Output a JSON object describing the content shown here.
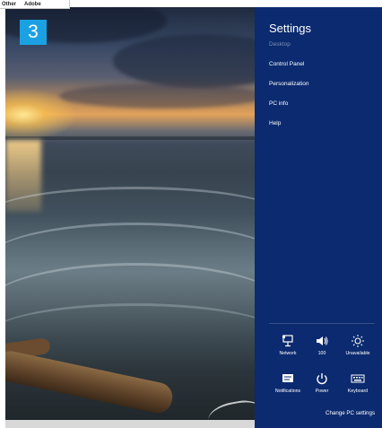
{
  "menubar": {
    "items": [
      "Other",
      "Adobe"
    ]
  },
  "step_badge": "3",
  "settings_pane": {
    "title": "Settings",
    "items": [
      {
        "label": "Desktop",
        "enabled": false
      },
      {
        "label": "Control Panel",
        "enabled": true
      },
      {
        "label": "Personalization",
        "enabled": true
      },
      {
        "label": "PC info",
        "enabled": true
      },
      {
        "label": "Help",
        "enabled": true
      }
    ],
    "tiles": [
      {
        "label": "Network",
        "icon": "network-icon"
      },
      {
        "label": "100",
        "icon": "volume-icon"
      },
      {
        "label": "Unavailable",
        "icon": "brightness-icon"
      },
      {
        "label": "Notifications",
        "icon": "notifications-icon"
      },
      {
        "label": "Power",
        "icon": "power-icon"
      },
      {
        "label": "Keyboard",
        "icon": "keyboard-icon"
      }
    ],
    "change_pc_settings": "Change PC settings"
  },
  "colors": {
    "pane_bg": "#0b2a6f",
    "badge_bg": "#1ba1e2",
    "disabled_text": "#7f8fb2"
  }
}
